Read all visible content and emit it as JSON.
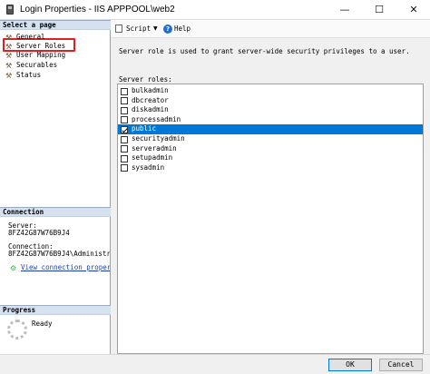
{
  "window": {
    "title": "Login Properties - IIS APPPOOL\\web2",
    "minimize_glyph": "—",
    "maximize_glyph": "☐",
    "close_glyph": "✕"
  },
  "left_pane": {
    "select_page_header": "Select a page",
    "pages": [
      {
        "label": "General",
        "icon": "wrench-icon"
      },
      {
        "label": "Server Roles",
        "icon": "wrench-icon",
        "highlighted": true
      },
      {
        "label": "User Mapping",
        "icon": "wrench-icon"
      },
      {
        "label": "Securables",
        "icon": "wrench-icon"
      },
      {
        "label": "Status",
        "icon": "wrench-icon"
      }
    ],
    "connection_header": "Connection",
    "server_label": "Server:",
    "server_value": "8FZ42G87W76B9J4",
    "connection_label": "Connection:",
    "connection_value": "8FZ42G87W76B9J4\\Administrat",
    "view_connection_link": "View connection properti",
    "progress_header": "Progress",
    "progress_status": "Ready"
  },
  "toolbar": {
    "script_label": "Script",
    "script_dropdown_glyph": "▼",
    "help_label": "Help",
    "help_glyph": "?"
  },
  "main": {
    "description": "Server role is used to grant server-wide security privileges to a user.",
    "roles_label": "Server roles:",
    "roles": [
      {
        "name": "bulkadmin",
        "checked": false,
        "selected": false
      },
      {
        "name": "dbcreator",
        "checked": false,
        "selected": false
      },
      {
        "name": "diskadmin",
        "checked": false,
        "selected": false
      },
      {
        "name": "processadmin",
        "checked": false,
        "selected": false
      },
      {
        "name": "public",
        "checked": true,
        "selected": true
      },
      {
        "name": "securityadmin",
        "checked": false,
        "selected": false
      },
      {
        "name": "serveradmin",
        "checked": false,
        "selected": false
      },
      {
        "name": "setupadmin",
        "checked": false,
        "selected": false
      },
      {
        "name": "sysadmin",
        "checked": false,
        "selected": false
      }
    ]
  },
  "footer": {
    "ok_label": "OK",
    "cancel_label": "Cancel"
  },
  "colors": {
    "selection": "#0078d7",
    "highlight_box": "#e02020",
    "link": "#1a3fb8",
    "pane_header": "#d6e1f0"
  }
}
